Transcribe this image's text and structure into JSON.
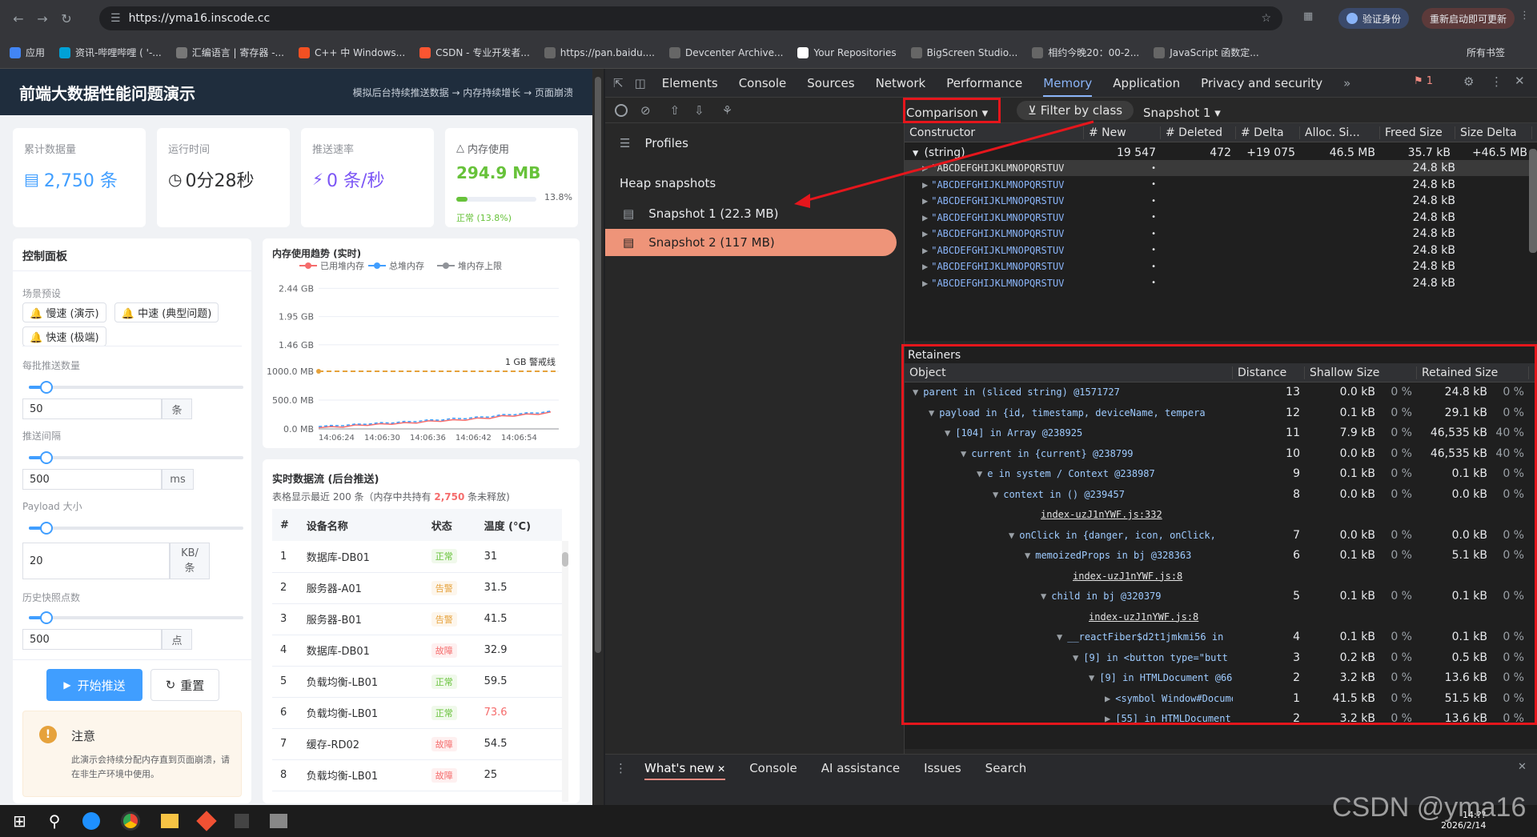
{
  "browser": {
    "url": "https://yma16.inscode.cc",
    "verify_label": "验证身份",
    "update_label": "重新启动即可更新",
    "bookmarks": [
      "应用",
      "资讯-哔哩哔哩 ( '-...",
      "汇编语言 | 寄存器 -...",
      "C++ 中 Windows...",
      "CSDN - 专业开发者...",
      "https://pan.baidu....",
      "Devcenter Archive...",
      "Your Repositories",
      "BigScreen Studio...",
      "相约今晚20：00-2...",
      "JavaScript 函数定..."
    ],
    "all_bookmarks": "所有书签"
  },
  "app": {
    "title": "前端大数据性能问题演示",
    "subtitle": "模拟后台持续推送数据 → 内存持续增长 → 页面崩溃",
    "stats": [
      {
        "label": "累计数据量",
        "value": "2,750 条",
        "color": "#409eff"
      },
      {
        "label": "运行时间",
        "value": "0分28秒",
        "color": "#303133"
      },
      {
        "label": "推送速率",
        "value": "0 条/秒",
        "color": "#7b55f5"
      },
      {
        "label": "内存使用",
        "value": "294.9 MB",
        "color": "#67c23a",
        "percent": "13.8%",
        "status": "正常 (13.8%)",
        "fill": 0.138
      }
    ],
    "control": {
      "title": "控制面板",
      "preset_label": "场景预设",
      "presets": [
        "慢速 (演示)",
        "中速 (典型问题)",
        "快速 (极端)"
      ],
      "batch_label": "每批推送数量",
      "batch_value": "50",
      "batch_unit": "条",
      "interval_label": "推送间隔",
      "interval_value": "500",
      "interval_unit": "ms",
      "payload_label": "Payload 大小",
      "payload_value": "20",
      "payload_unit": "KB/条",
      "history_label": "历史快照点数",
      "history_value": "500",
      "history_unit": "点",
      "start_label": "开始推送",
      "reset_label": "重置",
      "note_title": "注意",
      "note_text": "此演示会持续分配内存直到页面崩溃，请在非生产环境中使用。"
    },
    "chart_title": "内存使用趋势 (实时)",
    "table_title": "实时数据流 (后台推送)",
    "table_note_pre": "表格显示最近 200 条（内存中共持有 ",
    "table_note_count": "2,750",
    "table_note_post": " 条未释放)",
    "table_headers": [
      "#",
      "设备名称",
      "状态",
      "温度 (°C)"
    ],
    "rows": [
      {
        "id": "1",
        "name": "数据库-DB01",
        "status": "正常",
        "cls": "ok",
        "temp": "31",
        "hot": false
      },
      {
        "id": "2",
        "name": "服务器-A01",
        "status": "告警",
        "cls": "warn",
        "temp": "31.5",
        "hot": false
      },
      {
        "id": "3",
        "name": "服务器-B01",
        "status": "告警",
        "cls": "warn",
        "temp": "41.5",
        "hot": false
      },
      {
        "id": "4",
        "name": "数据库-DB01",
        "status": "故障",
        "cls": "err",
        "temp": "32.9",
        "hot": false
      },
      {
        "id": "5",
        "name": "负载均衡-LB01",
        "status": "正常",
        "cls": "ok",
        "temp": "59.5",
        "hot": false
      },
      {
        "id": "6",
        "name": "负载均衡-LB01",
        "status": "正常",
        "cls": "ok",
        "temp": "73.6",
        "hot": true
      },
      {
        "id": "7",
        "name": "缓存-RD02",
        "status": "故障",
        "cls": "err",
        "temp": "54.5",
        "hot": false
      },
      {
        "id": "8",
        "name": "负载均衡-LB01",
        "status": "故障",
        "cls": "err",
        "temp": "25",
        "hot": false
      }
    ]
  },
  "chart_data": {
    "type": "line",
    "title": "内存使用趋势 (实时)",
    "legend": [
      "已用堆内存",
      "总堆内存",
      "堆内存上限"
    ],
    "y_ticks": [
      "0.0 MB",
      "500.0 MB",
      "1000.0 MB",
      "1.46 GB",
      "1.95 GB",
      "2.44 GB"
    ],
    "x_ticks": [
      "14:06:24",
      "14:06:30",
      "14:06:36",
      "14:06:42",
      "14:06:54"
    ],
    "ylim": [
      0,
      2500
    ],
    "threshold_label": "1 GB 警戒线",
    "threshold_value": 1000,
    "series": [
      {
        "name": "已用堆内存",
        "color": "#f56c6c",
        "values": [
          20,
          40,
          30,
          70,
          60,
          90,
          80,
          110,
          100,
          140,
          130,
          160,
          150,
          190,
          180,
          230,
          220,
          260,
          250,
          295
        ]
      },
      {
        "name": "总堆内存",
        "color": "#409eff",
        "values": [
          40,
          60,
          55,
          85,
          80,
          110,
          100,
          130,
          125,
          160,
          150,
          185,
          175,
          210,
          205,
          250,
          245,
          280,
          275,
          310
        ]
      }
    ]
  },
  "devtools": {
    "tabs": [
      "Elements",
      "Console",
      "Sources",
      "Network",
      "Performance",
      "Memory",
      "Application",
      "Privacy and security"
    ],
    "active_tab": "Memory",
    "issues_count": "1",
    "view_mode": "Comparison",
    "filter_label": "Filter by class",
    "base_snapshot": "Snapshot 1",
    "profiles_label": "Profiles",
    "heap_title": "Heap snapshots",
    "snapshots": [
      "Snapshot 1 (22.3 MB)",
      "Snapshot 2 (117 MB)"
    ],
    "cmp_headers": [
      "Constructor",
      "# New",
      "# Deleted",
      "# Delta",
      "Alloc. Si...",
      "Freed Size",
      "Size Delta"
    ],
    "cmp_group": {
      "name": "(string)",
      "new": "19 547",
      "deleted": "472",
      "delta": "+19 075",
      "alloc": "46.5 MB",
      "freed": "35.7 kB",
      "sdelta": "+46.5 MB"
    },
    "cmp_item_text": "\"ABCDEFGHIJKLMNOPQRSTUV",
    "cmp_item_dot": "•",
    "cmp_item_size": "24.8 kB",
    "retainers_title": "Retainers",
    "ret_headers": [
      "Object",
      "Distance",
      "Shallow Size",
      "Retained Size"
    ],
    "ret_rows": [
      {
        "indent": 0,
        "text": "parent in (sliced string) @1571727",
        "dist": "13",
        "sh": "0.0 kB",
        "shp": "0 %",
        "rt": "24.8 kB",
        "rtp": "0 %"
      },
      {
        "indent": 1,
        "text": "payload in {id, timestamp, deviceName, tempera",
        "dist": "12",
        "sh": "0.1 kB",
        "shp": "0 %",
        "rt": "29.1 kB",
        "rtp": "0 %"
      },
      {
        "indent": 2,
        "text": "[104] in Array @238925",
        "dist": "11",
        "sh": "7.9 kB",
        "shp": "0 %",
        "rt": "46,535 kB",
        "rtp": "40 %"
      },
      {
        "indent": 3,
        "text": "current in {current} @238799",
        "dist": "10",
        "sh": "0.0 kB",
        "shp": "0 %",
        "rt": "46,535 kB",
        "rtp": "40 %"
      },
      {
        "indent": 4,
        "text": "e in system / Context @238987",
        "dist": "9",
        "sh": "0.1 kB",
        "shp": "0 %",
        "rt": "0.1 kB",
        "rtp": "0 %"
      },
      {
        "indent": 5,
        "text": "context in () @239457",
        "dist": "8",
        "sh": "0.0 kB",
        "shp": "0 %",
        "rt": "0.0 kB",
        "rtp": "0 %"
      },
      {
        "indent": 5,
        "text": "index-uzJ1nYWF.js:332",
        "dist": "",
        "sh": "",
        "shp": "",
        "rt": "",
        "rtp": "",
        "link": true
      },
      {
        "indent": 6,
        "text": "onClick in {danger, icon, onClick,",
        "dist": "7",
        "sh": "0.0 kB",
        "shp": "0 %",
        "rt": "0.0 kB",
        "rtp": "0 %"
      },
      {
        "indent": 7,
        "text": "memoizedProps in bj @328363",
        "dist": "6",
        "sh": "0.1 kB",
        "shp": "0 %",
        "rt": "5.1 kB",
        "rtp": "0 %"
      },
      {
        "indent": 7,
        "text": "index-uzJ1nYWF.js:8",
        "dist": "",
        "sh": "",
        "shp": "",
        "rt": "",
        "rtp": "",
        "link": true
      },
      {
        "indent": 8,
        "text": "child in bj @320379",
        "dist": "5",
        "sh": "0.1 kB",
        "shp": "0 %",
        "rt": "0.1 kB",
        "rtp": "0 %"
      },
      {
        "indent": 8,
        "text": "index-uzJ1nYWF.js:8",
        "dist": "",
        "sh": "",
        "shp": "",
        "rt": "",
        "rtp": "",
        "link": true
      },
      {
        "indent": 9,
        "text": "__reactFiber$d2t1jmkmi56 in",
        "dist": "4",
        "sh": "0.1 kB",
        "shp": "0 %",
        "rt": "0.1 kB",
        "rtp": "0 %"
      },
      {
        "indent": 10,
        "text": "[9] in <button type=\"butt",
        "dist": "3",
        "sh": "0.2 kB",
        "shp": "0 %",
        "rt": "0.5 kB",
        "rtp": "0 %"
      },
      {
        "indent": 11,
        "text": "[9] in HTMLDocument @66",
        "dist": "2",
        "sh": "3.2 kB",
        "shp": "0 %",
        "rt": "13.6 kB",
        "rtp": "0 %"
      },
      {
        "indent": 12,
        "text": "<symbol Window#Docume",
        "dist": "1",
        "sh": "41.5 kB",
        "shp": "0 %",
        "rt": "51.5 kB",
        "rtp": "0 %"
      },
      {
        "indent": 12,
        "text": "[55] in HTMLDocument",
        "dist": "2",
        "sh": "3.2 kB",
        "shp": "0 %",
        "rt": "13.6 kB",
        "rtp": "0 %"
      }
    ],
    "drawer_tabs": [
      "What's new",
      "Console",
      "AI assistance",
      "Issues",
      "Search"
    ]
  },
  "watermark": "CSDN @yma16",
  "taskbar": {
    "time": "14:??",
    "date": "2026/2/14"
  }
}
